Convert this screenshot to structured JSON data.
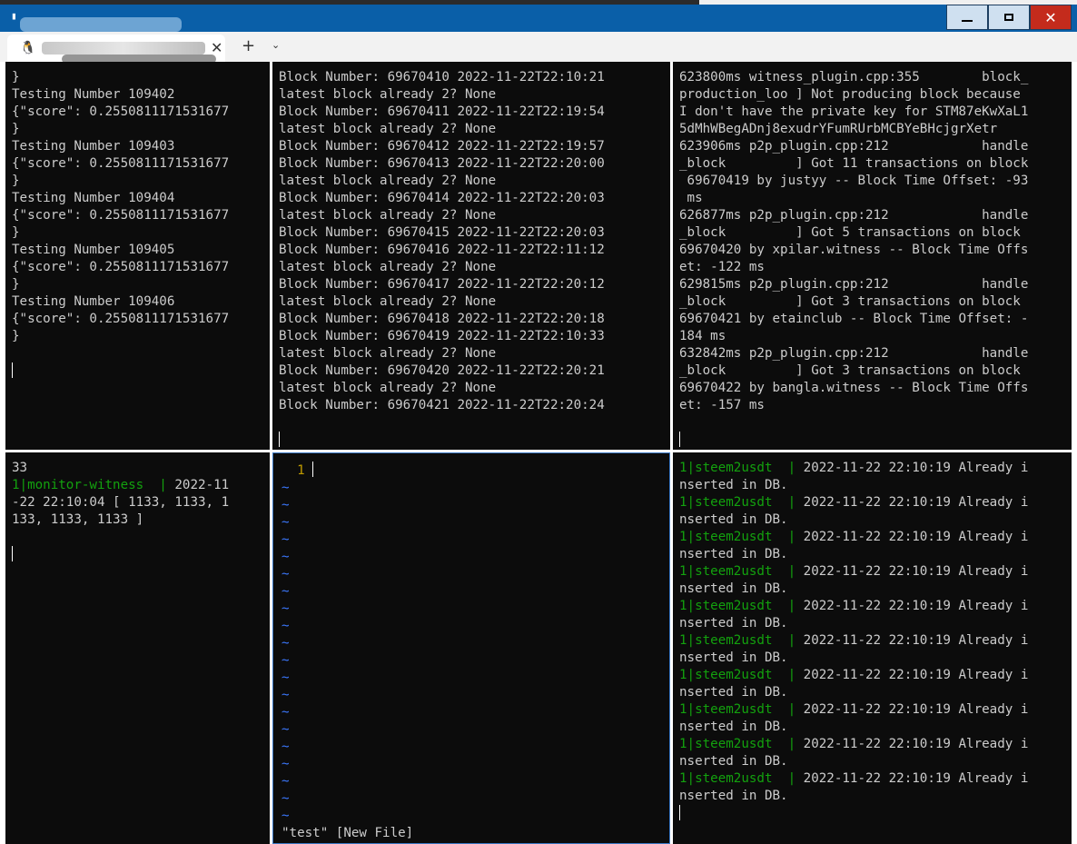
{
  "window": {
    "minimize_label": "—",
    "maximize_label": "□",
    "close_label": "✕"
  },
  "tabbar": {
    "tab_icon": "linux-tux-icon",
    "tab_close": "✕",
    "new_tab": "+",
    "dropdown": "⌄"
  },
  "panes": {
    "top_left": [
      "}",
      "Testing Number 109402",
      "{\"score\": 0.2550811171531677",
      "}",
      "Testing Number 109403",
      "{\"score\": 0.2550811171531677",
      "}",
      "Testing Number 109404",
      "{\"score\": 0.2550811171531677",
      "}",
      "Testing Number 109405",
      "{\"score\": 0.2550811171531677",
      "}",
      "Testing Number 109406",
      "{\"score\": 0.2550811171531677",
      "}"
    ],
    "top_middle": [
      "Block Number: 69670410 2022-11-22T22:10:21",
      "latest block already 2? None",
      "Block Number: 69670411 2022-11-22T22:19:54",
      "latest block already 2? None",
      "Block Number: 69670412 2022-11-22T22:19:57",
      "Block Number: 69670413 2022-11-22T22:20:00",
      "latest block already 2? None",
      "Block Number: 69670414 2022-11-22T22:20:03",
      "latest block already 2? None",
      "Block Number: 69670415 2022-11-22T22:20:03",
      "Block Number: 69670416 2022-11-22T22:11:12",
      "latest block already 2? None",
      "Block Number: 69670417 2022-11-22T22:20:12",
      "latest block already 2? None",
      "Block Number: 69670418 2022-11-22T22:20:18",
      "Block Number: 69670419 2022-11-22T22:10:33",
      "latest block already 2? None",
      "Block Number: 69670420 2022-11-22T22:20:21",
      "latest block already 2? None",
      "Block Number: 69670421 2022-11-22T22:20:24"
    ],
    "top_right": [
      "623800ms witness_plugin.cpp:355        block_",
      "production_loo ] Not producing block because",
      "I don't have the private key for STM87eKwXaL1",
      "5dMhWBegADnj8exudrYFumRUrbMCBYeBHcjgrXetr",
      "623906ms p2p_plugin.cpp:212            handle",
      "_block         ] Got 11 transactions on block",
      " 69670419 by justyy -- Block Time Offset: -93",
      " ms",
      "626877ms p2p_plugin.cpp:212            handle",
      "_block         ] Got 5 transactions on block",
      "69670420 by xpilar.witness -- Block Time Offs",
      "et: -122 ms",
      "629815ms p2p_plugin.cpp:212            handle",
      "_block         ] Got 3 transactions on block",
      "69670421 by etainclub -- Block Time Offset: -",
      "184 ms",
      "632842ms p2p_plugin.cpp:212            handle",
      "_block         ] Got 3 transactions on block",
      "69670422 by bangla.witness -- Block Time Offs",
      "et: -157 ms"
    ],
    "bottom_left": {
      "line1": "33",
      "line2_green": "1|monitor-witness  |",
      "line2_rest": " 2022-11",
      "line3": "-22 22:10:04 [ 1133, 1133, 1",
      "line4": "133, 1133, 1133 ]"
    },
    "bottom_middle": {
      "line_number": "  1",
      "tilde": "~",
      "status": "\"test\" [New File]"
    },
    "bottom_right": {
      "prefix": "1|steem2usdt  |",
      "message": " 2022-11-22 22:10:19 Already i",
      "continuation": "nserted in DB.",
      "repeat": 10
    }
  }
}
